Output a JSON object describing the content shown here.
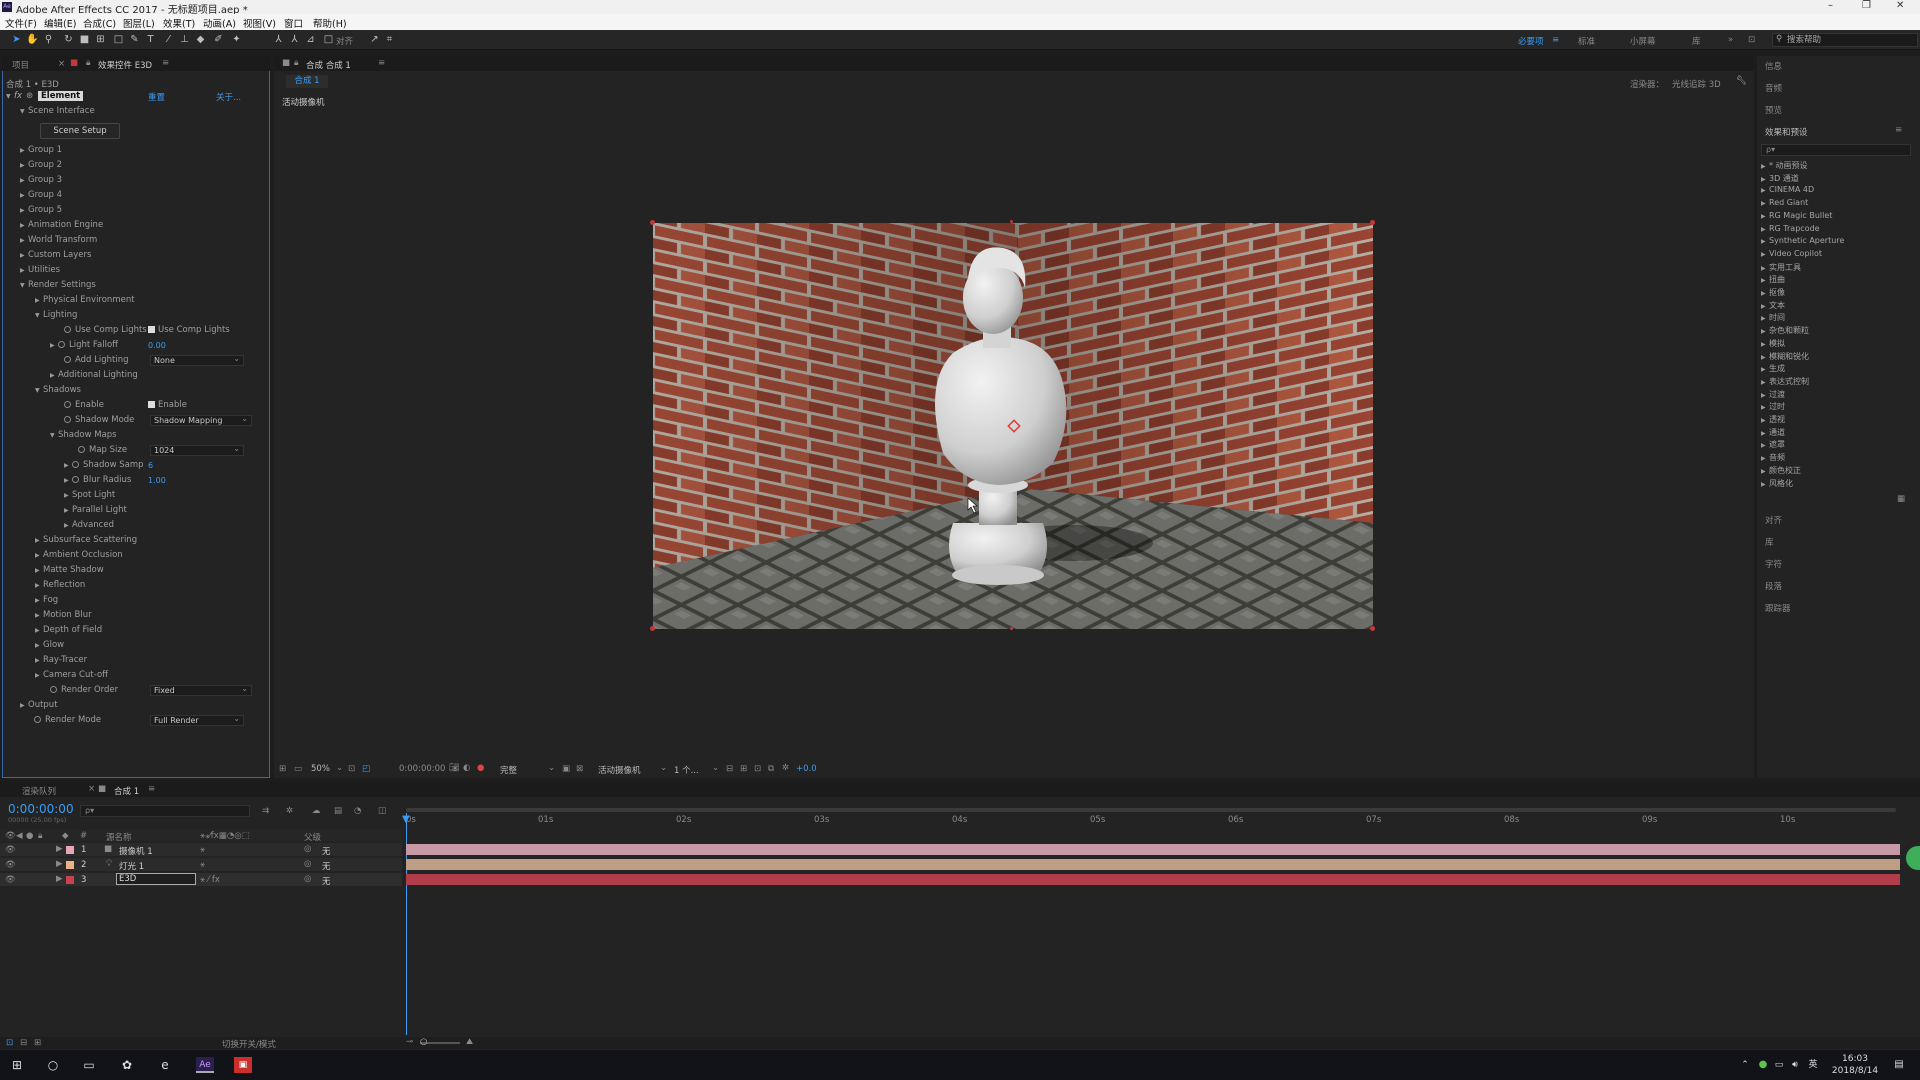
{
  "window": {
    "title": "Adobe After Effects CC 2017 - 无标题项目.aep *",
    "logo": "Ae",
    "controls": [
      "–",
      "❐",
      "✕"
    ]
  },
  "menu": [
    "文件(F)",
    "编辑(E)",
    "合成(C)",
    "图层(L)",
    "效果(T)",
    "动画(A)",
    "视图(V)",
    "窗口",
    "帮助(H)"
  ],
  "toolbar": {
    "align_label": "对齐",
    "workspaces": [
      "必要项",
      "标准",
      "小屏幕",
      "库"
    ],
    "search_placeholder": "搜索帮助"
  },
  "left_panel": {
    "tab1": "项目",
    "tab2": "效果控件 E3D",
    "breadcrumb": "合成 1 • E3D",
    "effect_name": "Element",
    "reset_label": "重置",
    "about_label": "关于...",
    "scene_interface": "Scene Interface",
    "scene_setup_button": "Scene Setup",
    "tree": {
      "group1": "Group 1",
      "group2": "Group 2",
      "group3": "Group 3",
      "group4": "Group 4",
      "group5": "Group 5",
      "animation_engine": "Animation Engine",
      "world_transform": "World Transform",
      "custom_layers": "Custom Layers",
      "utilities": "Utilities",
      "render_settings": "Render Settings",
      "physical_environment": "Physical Environment",
      "lighting": "Lighting",
      "use_comp_lights": "Use Comp Lights",
      "use_comp_lights_value": "Use Comp Lights",
      "light_falloff": "Light Falloff",
      "light_falloff_value": "0.00",
      "add_lighting": "Add Lighting",
      "add_lighting_value": "None",
      "additional_lighting": "Additional Lighting",
      "shadows": "Shadows",
      "enable": "Enable",
      "enable_value": "Enable",
      "shadow_mode": "Shadow Mode",
      "shadow_mode_value": "Shadow Mapping",
      "shadow_maps": "Shadow Maps",
      "map_size": "Map Size",
      "map_size_value": "1024",
      "shadow_samples": "Shadow Samp",
      "shadow_samples_value": "6",
      "blur_radius": "Blur Radius",
      "blur_radius_value": "1.00",
      "spot_light": "Spot Light",
      "parallel_light": "Parallel Light",
      "advanced": "Advanced",
      "subsurface_scattering": "Subsurface Scattering",
      "ambient_occlusion": "Ambient Occlusion",
      "matte_shadow": "Matte Shadow",
      "reflection": "Reflection",
      "fog": "Fog",
      "motion_blur": "Motion Blur",
      "depth_of_field": "Depth of Field",
      "glow": "Glow",
      "ray_tracer": "Ray-Tracer",
      "camera_cutoff": "Camera Cut-off",
      "render_order": "Render Order",
      "render_order_value": "Fixed",
      "output": "Output",
      "render_mode": "Render Mode",
      "render_mode_value": "Full Render"
    }
  },
  "comp_viewer": {
    "tab": "合成 合成 1",
    "sub_tab": "合成 1",
    "active_camera": "活动摄像机",
    "renderer_label": "渲染器：",
    "renderer_value": "光线追踪 3D",
    "footer": {
      "zoom": "50%",
      "timecode": "0:00:00:00",
      "resolution": "完整",
      "camera": "活动摄像机",
      "views": "1 个...",
      "exposure": "+0.0"
    }
  },
  "right_panel": {
    "info": "信息",
    "audio": "音频",
    "preview": "预览",
    "effects_presets": "效果和预设",
    "search_placeholder": "ρ▾",
    "categories": [
      "* 动画预设",
      "3D 通道",
      "CINEMA 4D",
      "Red Giant",
      "RG Magic Bullet",
      "RG Trapcode",
      "Synthetic Aperture",
      "Video Copilot",
      "实用工具",
      "扭曲",
      "抠像",
      "文本",
      "时间",
      "杂色和颗粒",
      "模拟",
      "模糊和锐化",
      "生成",
      "表达式控制",
      "过渡",
      "过时",
      "透视",
      "通道",
      "遮罩",
      "音频",
      "颜色校正",
      "风格化"
    ],
    "align": "对齐",
    "library": "库",
    "character": "字符",
    "paragraph": "段落",
    "tracker": "跟踪器"
  },
  "timeline": {
    "tab_render_queue": "渲染队列",
    "tab_comp": "合成 1",
    "timecode": "0:00:00:00",
    "fps": "00000 (25.00 fps)",
    "search_placeholder": "ρ▾",
    "col_source": "源名称",
    "col_parent": "父级",
    "ruler": [
      "0s",
      "01s",
      "02s",
      "03s",
      "04s",
      "05s",
      "06s",
      "07s",
      "08s",
      "09s",
      "10s"
    ],
    "layers": [
      {
        "index": "1",
        "name": "摄像机 1",
        "parent": "无",
        "color": "#e6a8b8"
      },
      {
        "index": "2",
        "name": "灯光 1",
        "parent": "无",
        "color": "#e8b486"
      },
      {
        "index": "3",
        "name": "E3D",
        "parent": "无",
        "color": "#c8414e"
      }
    ],
    "footer_label": "切换开关/模式"
  },
  "taskbar": {
    "time": "16:03",
    "date": "2018/8/14",
    "ime": "英"
  }
}
